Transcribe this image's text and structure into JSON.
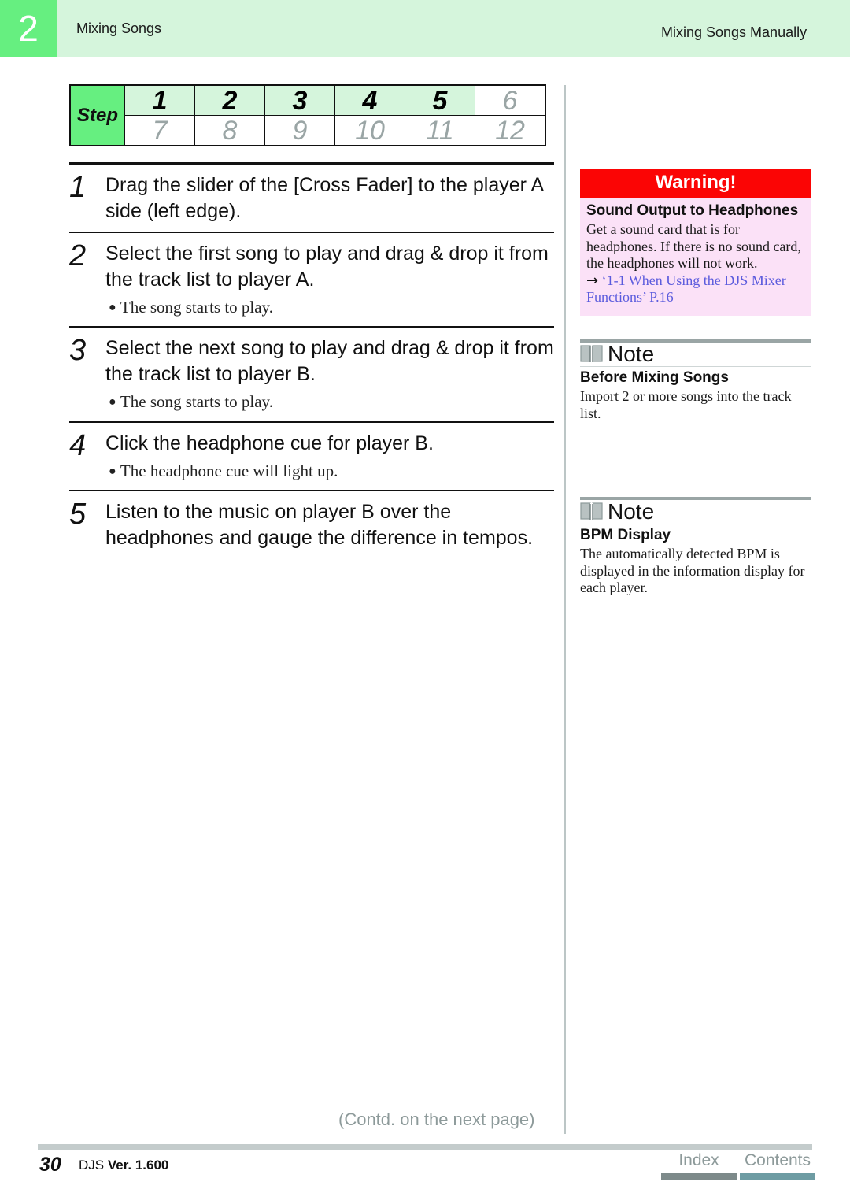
{
  "header": {
    "chapter_number": "2",
    "left_title": "Mixing Songs",
    "right_title": "Mixing Songs Manually",
    "band_color": "#d5f5dc",
    "badge_color": "#66ef80"
  },
  "step_table": {
    "label": "Step",
    "row1": [
      {
        "num": "1",
        "state": "on"
      },
      {
        "num": "2",
        "state": "on"
      },
      {
        "num": "3",
        "state": "on"
      },
      {
        "num": "4",
        "state": "on"
      },
      {
        "num": "5",
        "state": "on"
      },
      {
        "num": "6",
        "state": "off"
      }
    ],
    "row2": [
      {
        "num": "7",
        "state": "off"
      },
      {
        "num": "8",
        "state": "off"
      },
      {
        "num": "9",
        "state": "off"
      },
      {
        "num": "10",
        "state": "off"
      },
      {
        "num": "11",
        "state": "off"
      },
      {
        "num": "12",
        "state": "off"
      }
    ]
  },
  "steps": [
    {
      "number": "1",
      "text": "Drag the slider of the [Cross Fader] to the player A side (left edge).",
      "bullets": []
    },
    {
      "number": "2",
      "text": "Select the first song to play and drag & drop it from the track list to player A.",
      "bullets": [
        "The song starts to play."
      ]
    },
    {
      "number": "3",
      "text": "Select the next song to play and drag & drop it from the track list to player B.",
      "bullets": [
        "The song starts to play."
      ]
    },
    {
      "number": "4",
      "text": "Click the headphone cue for player B.",
      "bullets": [
        "The headphone cue will light up."
      ]
    },
    {
      "number": "5",
      "text": "Listen to the music on player B over the headphones and gauge the difference in tempos.",
      "bullets": []
    }
  ],
  "warning": {
    "title": "Warning!",
    "subtitle": "Sound Output to Headphones",
    "body": "Get a sound card that is for headphones. If there is no sound card, the headphones will not work.",
    "arrow": "→",
    "link": "‘1-1 When Using the DJS Mixer Functions’ P.16",
    "header_color": "#fb0505",
    "body_color": "#fbe1f7",
    "link_color": "#5b5bdd"
  },
  "notes": [
    {
      "label": "Note",
      "subtitle": "Before Mixing Songs",
      "body": "Import 2 or more songs into the track list."
    },
    {
      "label": "Note",
      "subtitle": "BPM Display",
      "body": "The automatically detected BPM is displayed in the information display for each player."
    }
  ],
  "footer": {
    "contd": "(Contd. on the next page)",
    "page_number": "30",
    "product": "DJS",
    "version": "Ver. 1.600",
    "nav": [
      {
        "label": "Index",
        "bar_color": "#7d8a8a"
      },
      {
        "label": "Contents",
        "bar_color": "#6e9ca3"
      }
    ]
  }
}
